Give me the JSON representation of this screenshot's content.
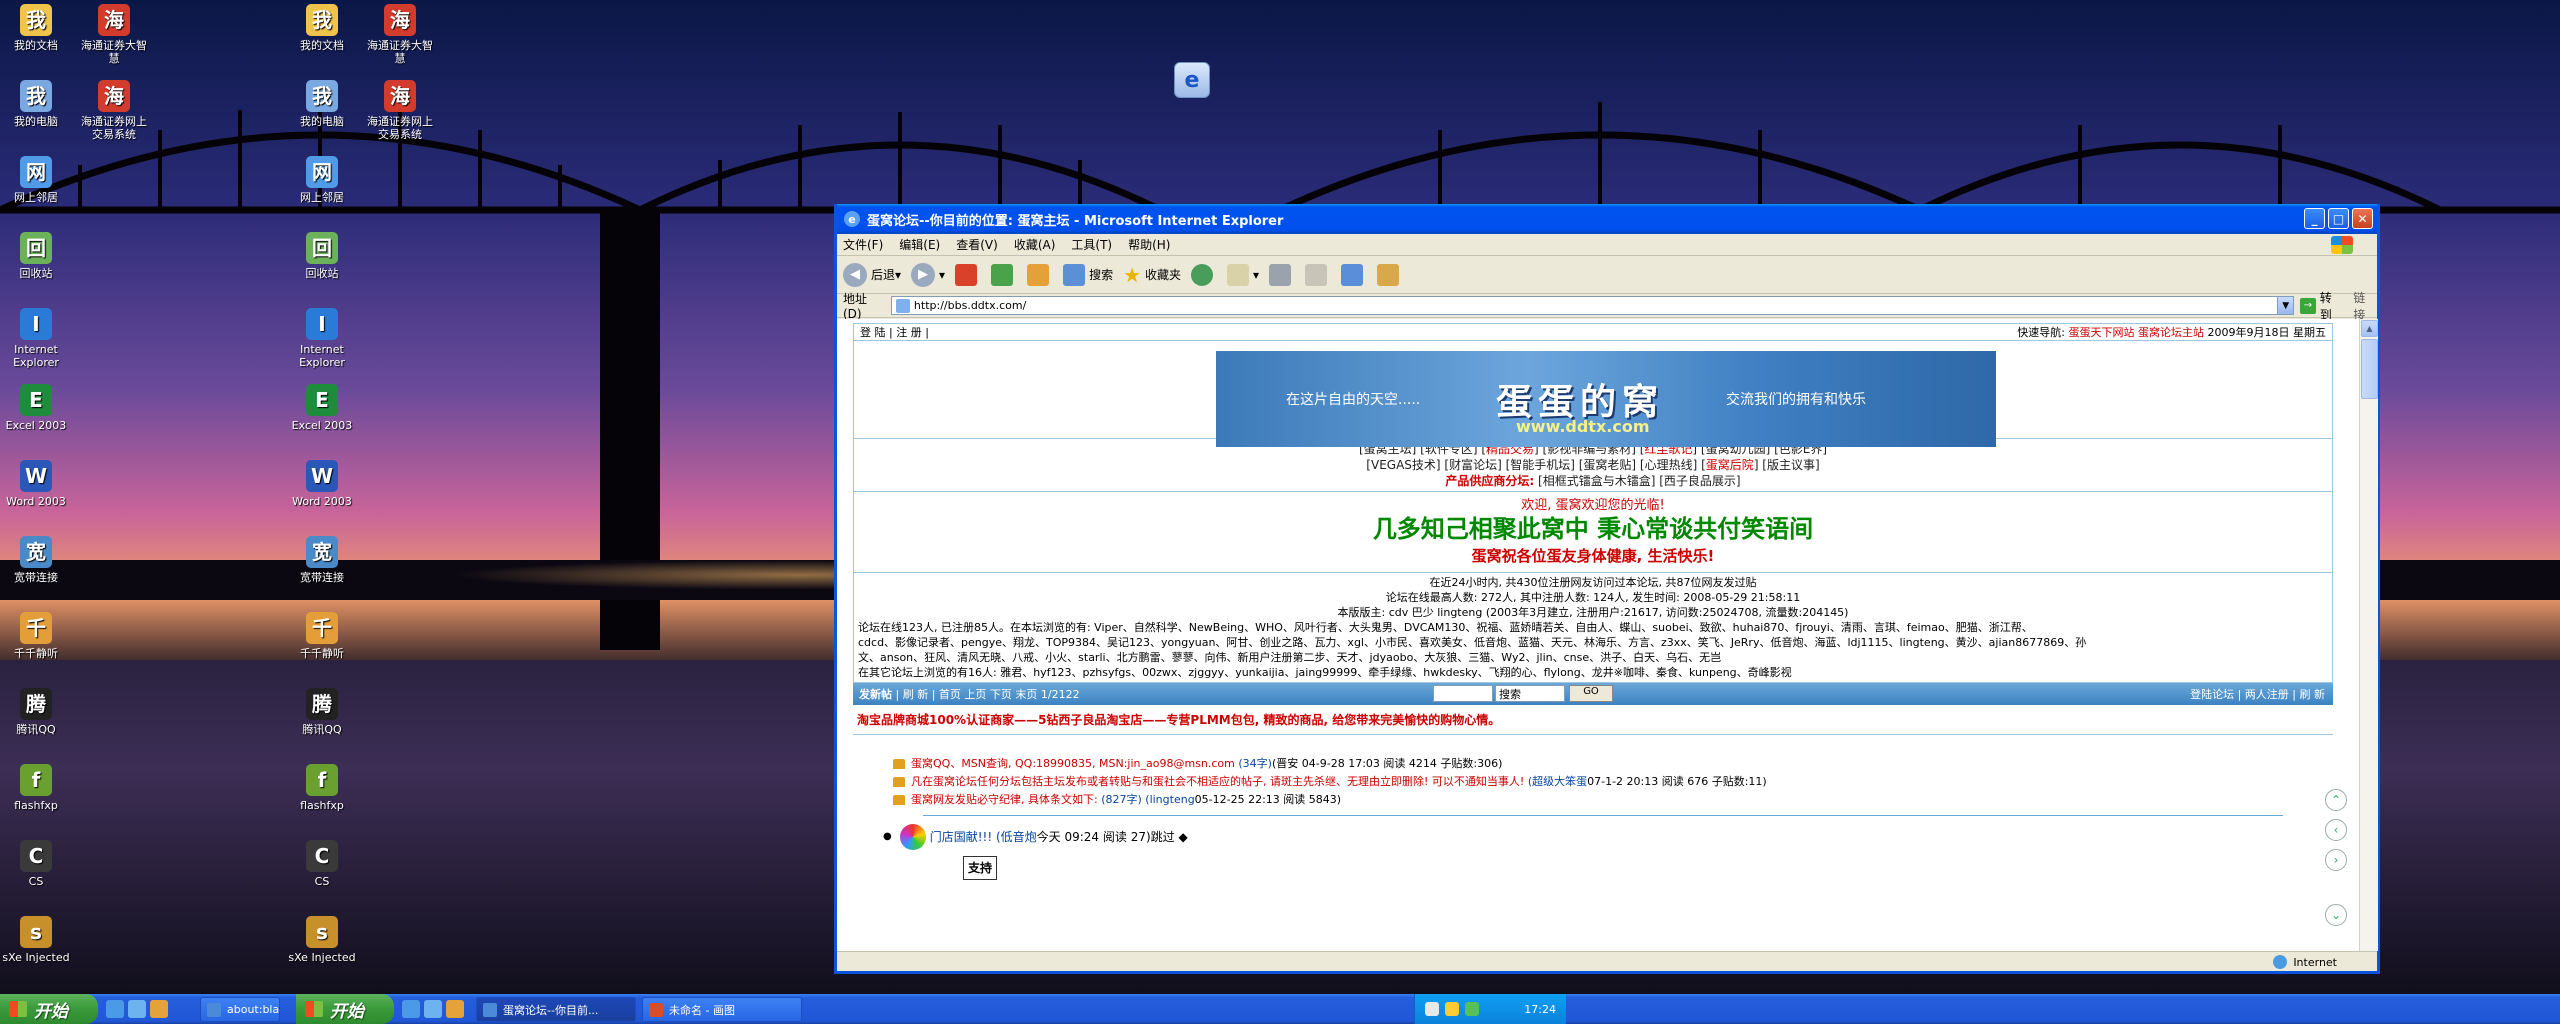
{
  "desktop": {
    "icons_left": [
      {
        "label": "我的文档",
        "color": "#f0c34a"
      },
      {
        "label": "海通证券大智慧",
        "color": "#d33b2c"
      },
      {
        "label": "我的电脑",
        "color": "#7aa8e0"
      },
      {
        "label": "海通证券网上交易系统",
        "color": "#d33b2c"
      },
      {
        "label": "网上邻居",
        "color": "#4f9be8"
      },
      {
        "label": "回收站",
        "color": "#6bb25a"
      },
      {
        "label": "Internet Explorer",
        "color": "#2a7ad8"
      },
      {
        "label": "Excel 2003",
        "color": "#1f8b3c"
      },
      {
        "label": "Word 2003",
        "color": "#2b57b8"
      },
      {
        "label": "宽带连接",
        "color": "#4a8ac8"
      },
      {
        "label": "千千静听",
        "color": "#e39e3a"
      },
      {
        "label": "腾讯QQ",
        "color": "#222222"
      },
      {
        "label": "flashfxp",
        "color": "#6aa02f"
      },
      {
        "label": "CS",
        "color": "#3a3a3a"
      },
      {
        "label": "sXe Injected",
        "color": "#c8902a"
      }
    ]
  },
  "taskbar": {
    "start_label": "开始",
    "buttons": [
      {
        "label": "about:blan"
      },
      {
        "label": "蛋窝论坛--你目前..."
      },
      {
        "label": "未命名 - 画图"
      }
    ],
    "clock": "17:24"
  },
  "window": {
    "title": "蛋窝论坛--你目前的位置: 蛋窝主坛 - Microsoft Internet Explorer",
    "menu": [
      "文件(F)",
      "编辑(E)",
      "查看(V)",
      "收藏(A)",
      "工具(T)",
      "帮助(H)"
    ],
    "toolbar": {
      "back": "后退",
      "search": "搜索",
      "favorites": "收藏夹"
    },
    "address_label": "地址(D)",
    "address_value": "http://bbs.ddtx.com/",
    "go_label": "转到",
    "links_label": "链接",
    "status_zone": "Internet"
  },
  "forum": {
    "topnav": {
      "login": "登 陆",
      "register": "注 册",
      "quicknav_label": "快速导航:",
      "quicknav_links": [
        "蛋蛋天下网站",
        "蛋窝论坛主站"
      ],
      "date": "2009年9月18日 星期五"
    },
    "banner": {
      "slogan_left": "在这片自由的天空.....",
      "title": "蛋蛋的窝",
      "url": "www.ddtx.com",
      "slogan_right": "交流我们的拥有和快乐"
    },
    "links_line1": "[蛋窝主坛] [软件专区] [",
    "links_line1_red": "精品交易",
    "links_line1_b": "] [影视非编与素材] [",
    "links_line1_red2": "红尘歌记",
    "links_line1_c": "] [蛋窝幼儿园] [色影E界]",
    "links_line2_a": "[VEGAS技术] [财富论坛] [智能手机坛] [蛋窝老贴] [心理热线] [",
    "links_line2_red": "蛋窝后院",
    "links_line2_b": "] [版主议事]",
    "supplier_label": "产品供应商分坛:",
    "supplier_links": "[相框式镭盒与木镭盒] [西子良品展示]",
    "welcome": {
      "line1": "欢迎, 蛋窝欢迎您的光临!",
      "line2": "几多知己相聚此窝中  秉心常谈共付笑语间",
      "line3": "蛋窝祝各位蛋友身体健康, 生活快乐!"
    },
    "stats": {
      "l1": "在近24小时内, 共430位注册网友访问过本论坛, 共87位网友发过贴",
      "l2": "论坛在线最高人数: 272人, 其中注册人数: 124人, 发生时间: 2008-05-29 21:58:11",
      "l3": "本版版主: cdv 巴少 lingteng      (2003年3月建立, 注册用户:21617, 访问数:25024708, 流量数:204145)",
      "l4": "论坛在线123人, 已注册85人。在本坛浏览的有: Viper、自然科学、NewBeing、WHO、风叶行者、大头鬼男、DVCAM130、祝福、蓝娇晴若关、自由人、蝶山、suobei、致欲、huhai870、fjrouyi、清雨、言琪、feimao、肥猫、浙江帮、",
      "l5": "cdcd、影像记录者、pengye、翔龙、TOP9384、吴记123、yongyuan、阿甘、创业之路、瓦力、xgl、小市民、喜欢美女、低音炮、蓝猫、天元、林海乐、方言、z3xx、笑飞、JeRry、低音炮、海蓝、ldj1115、lingteng、黄沙、ajian8677869、孙",
      "l6": "文、anson、狂风、清风无晓、八戒、小火、starli、北方鹏雷、蓼蓼、向伟、新用户注册第二步、天才、jdyaobo、大灰狼、三猫、Wy2、jlin、cnse、洪子、白天、乌石、无岂",
      "l7": "在其它论坛上浏览的有16人: 雅君、hyf123、pzhsyfgs、00zwx、zjggyy、yunkaijia、jaing99999、牵手绿缘、hwkdesky、飞翔的心、flylong、龙井※咖啡、秦食、kunpeng、奇峰影视"
    },
    "navbar": {
      "post": "发新帖",
      "refresh": "刷 新",
      "pages": "首页 上页 下页 末页 1/2122",
      "search_option": "搜索",
      "go": "GO",
      "right": "登陆论坛  |  两人注册  |  刷 新"
    },
    "promo": "淘宝品牌商城100%认证商家——5钻西子良品淘宝店——专营PLMM包包, 精致的商品, 给您带来完美愉快的购物心情。",
    "topics": [
      {
        "red": "蛋窝QQ、MSN查询, QQ:18990835, MSN:jin_ao98@msn.com",
        "blue": "(34字)",
        "meta": " (晋安 04-9-28 17:03 阅读 4214 子贴数:306)"
      },
      {
        "red": "凡在蛋窝论坛任何分坛包括主坛发布或者转贴与和蛋社会不相适应的帖子, 请斑主先杀继、无理由立即删除! 可以不通知当事人!",
        "blue": "(超级大笨蛋",
        "meta": " 07-1-2 20:13 阅读 676 子贴数:11)"
      },
      {
        "red": "蛋窝网友发贴必守纪律, 具体条文如下:",
        "blue": "(827字) (lingteng",
        "meta": " 05-12-25 22:13 阅读 5843)"
      }
    ],
    "first_topic": {
      "text": "门店国献!!! (低音炮",
      "meta": " 今天 09:24 阅读 27)跳过 ◆"
    },
    "tag": "支持"
  }
}
